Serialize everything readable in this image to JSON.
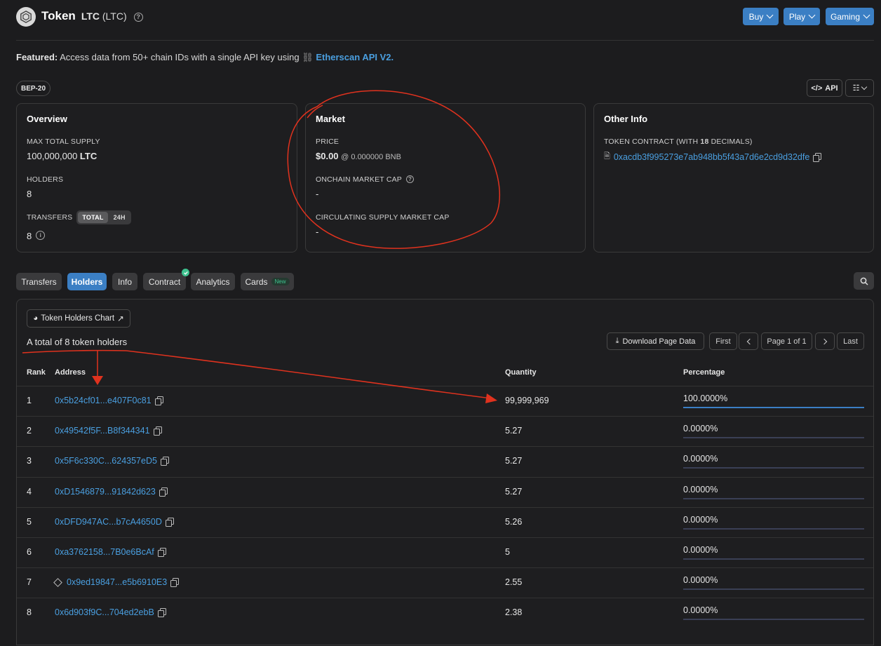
{
  "header": {
    "title": "Token",
    "symbol": "LTC",
    "symbol_paren": "(LTC)",
    "buttons": [
      "Buy",
      "Play",
      "Gaming"
    ]
  },
  "featured": {
    "label": "Featured:",
    "text": "Access data from 50+ chain IDs with a single API key using",
    "link": "Etherscan API V2."
  },
  "badge": "BEP-20",
  "api_button": "API",
  "overview": {
    "title": "Overview",
    "max_supply_label": "MAX TOTAL SUPPLY",
    "max_supply_value": "100,000,000",
    "max_supply_symbol": "LTC",
    "holders_label": "HOLDERS",
    "holders_value": "8",
    "transfers_label": "TRANSFERS",
    "transfers_toggle": [
      "TOTAL",
      "24H"
    ],
    "transfers_value": "8"
  },
  "market": {
    "title": "Market",
    "price_label": "PRICE",
    "price_value": "$0.00",
    "price_bnb": "@ 0.000000 BNB",
    "onchain_cap_label": "ONCHAIN MARKET CAP",
    "onchain_cap_value": "-",
    "circ_cap_label": "CIRCULATING SUPPLY MARKET CAP",
    "circ_cap_value": "-"
  },
  "other_info": {
    "title": "Other Info",
    "contract_label_pre": "TOKEN CONTRACT (WITH",
    "contract_decimals": "18",
    "contract_label_post": "DECIMALS)",
    "contract_address": "0xacdb3f995273e7ab948bb5f43a7d6e2cd9d32dfe"
  },
  "tabs": [
    "Transfers",
    "Holders",
    "Info",
    "Contract",
    "Analytics",
    "Cards"
  ],
  "new_badge": "New",
  "holders_panel": {
    "chart_button": "Token Holders Chart",
    "total_text": "A total of 8 token holders",
    "download_button": "Download Page Data",
    "pager": {
      "first": "First",
      "page": "Page 1 of 1",
      "last": "Last"
    },
    "columns": {
      "rank": "Rank",
      "address": "Address",
      "quantity": "Quantity",
      "percentage": "Percentage"
    },
    "rows": [
      {
        "rank": "1",
        "address": "0x5b24cf01...e407F0c81",
        "quantity": "99,999,969",
        "percentage": "100.0000%",
        "pct_value": 1.0,
        "contract_icon": false
      },
      {
        "rank": "2",
        "address": "0x49542f5F...B8f344341",
        "quantity": "5.27",
        "percentage": "0.0000%",
        "pct_value": 0.0,
        "contract_icon": false
      },
      {
        "rank": "3",
        "address": "0x5F6c330C...624357eD5",
        "quantity": "5.27",
        "percentage": "0.0000%",
        "pct_value": 0.0,
        "contract_icon": false
      },
      {
        "rank": "4",
        "address": "0xD1546879...91842d623",
        "quantity": "5.27",
        "percentage": "0.0000%",
        "pct_value": 0.0,
        "contract_icon": false
      },
      {
        "rank": "5",
        "address": "0xDFD947AC...b7cA4650D",
        "quantity": "5.26",
        "percentage": "0.0000%",
        "pct_value": 0.0,
        "contract_icon": false
      },
      {
        "rank": "6",
        "address": "0xa3762158...7B0e6BcAf",
        "quantity": "5",
        "percentage": "0.0000%",
        "pct_value": 0.0,
        "contract_icon": false
      },
      {
        "rank": "7",
        "address": "0x9ed19847...e5b6910E3",
        "quantity": "2.55",
        "percentage": "0.0000%",
        "pct_value": 0.0,
        "contract_icon": true
      },
      {
        "rank": "8",
        "address": "0x6d903f9C...704ed2ebB",
        "quantity": "2.38",
        "percentage": "0.0000%",
        "pct_value": 0.0,
        "contract_icon": false
      }
    ]
  },
  "colors": {
    "accent": "#3b7fc4",
    "link": "#4a9fe0",
    "annotation": "#e0321e",
    "success": "#3ec28f"
  }
}
